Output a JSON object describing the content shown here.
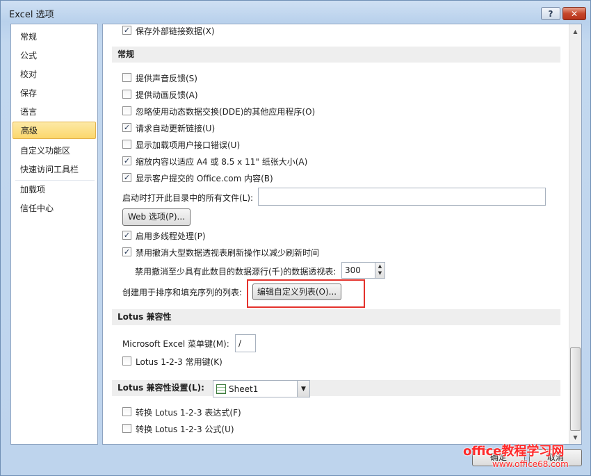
{
  "window": {
    "title": "Excel 选项",
    "help": "?",
    "close": "✕"
  },
  "sidebar": {
    "items": [
      "常规",
      "公式",
      "校对",
      "保存",
      "语言",
      "高级",
      "自定义功能区",
      "快速访问工具栏",
      "加载项",
      "信任中心"
    ],
    "active_index": 5
  },
  "content": {
    "top_partial": {
      "label": "保存外部链接数据(X)",
      "checked": true
    },
    "section_general": "常规",
    "options": [
      {
        "label": "提供声音反馈(S)",
        "checked": false
      },
      {
        "label": "提供动画反馈(A)",
        "checked": false
      },
      {
        "label": "忽略使用动态数据交换(DDE)的其他应用程序(O)",
        "checked": false
      },
      {
        "label": "请求自动更新链接(U)",
        "checked": true
      },
      {
        "label": "显示加载项用户接口错误(U)",
        "checked": false
      },
      {
        "label": "缩放内容以适应 A4 或 8.5 x 11\" 纸张大小(A)",
        "checked": true
      },
      {
        "label": "显示客户提交的 Office.com 内容(B)",
        "checked": true
      }
    ],
    "startup_open_label": "启动时打开此目录中的所有文件(L):",
    "startup_open_value": "",
    "web_options_button": "Web 选项(P)...",
    "multithread": {
      "label": "启用多线程处理(P)",
      "checked": true
    },
    "disable_undo_pivot": {
      "label": "禁用撤消大型数据透视表刷新操作以减少刷新时间",
      "checked": true
    },
    "undo_min_rows_label": "禁用撤消至少具有此数目的数据源行(千)的数据透视表:",
    "undo_min_rows_value": "300",
    "custom_list_label": "创建用于排序和填充序列的列表:",
    "custom_list_button": "编辑自定义列表(O)...",
    "section_lotus": "Lotus 兼容性",
    "menu_key_label": "Microsoft Excel 菜单键(M):",
    "menu_key_value": "/",
    "lotus_nav": {
      "label": "Lotus 1-2-3 常用键(K)",
      "checked": false
    },
    "section_lotus_settings": "Lotus 兼容性设置(L):",
    "sheet_select": "Sheet1",
    "lotus_formula_eval": {
      "label": "转换 Lotus 1-2-3 表达式(F)",
      "checked": false
    },
    "lotus_formula_entry": {
      "label": "转换 Lotus 1-2-3 公式(U)",
      "checked": false
    }
  },
  "footer": {
    "ok": "确定",
    "cancel": "取消"
  },
  "watermark": {
    "line1": "office教程学习网",
    "line2": "www.office68.com"
  }
}
